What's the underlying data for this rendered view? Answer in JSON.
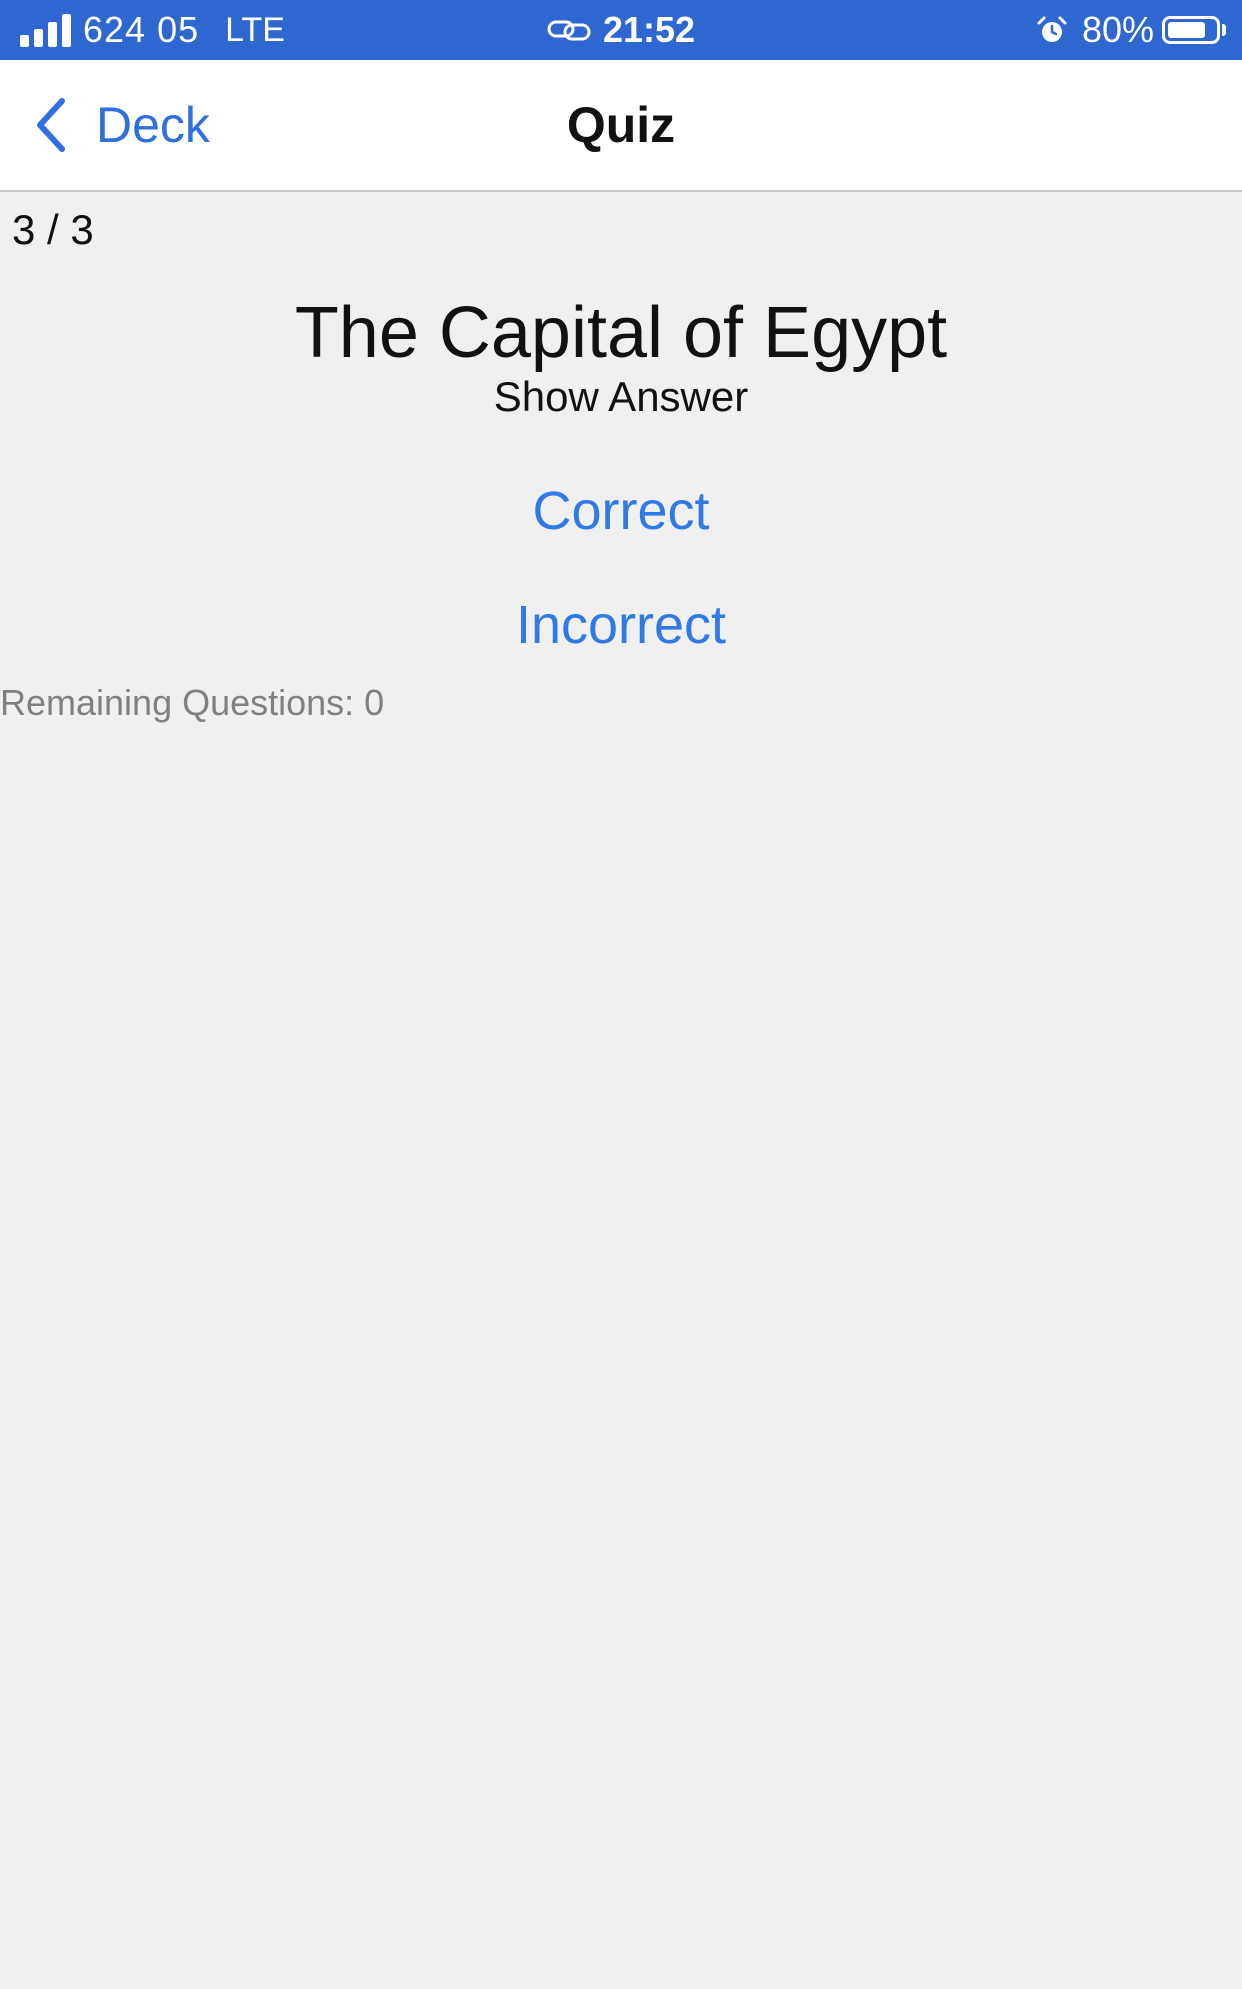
{
  "status_bar": {
    "carrier": "624 05",
    "network": "LTE",
    "time": "21:52",
    "battery_percent": "80%",
    "battery_level": 0.8,
    "icons": [
      "signal-icon",
      "link-icon",
      "alarm-icon",
      "battery-icon"
    ],
    "background_color": "#2f67d1"
  },
  "nav": {
    "back_label": "Deck",
    "title": "Quiz",
    "accent_color": "#2f6fe0"
  },
  "quiz": {
    "progress": "3 / 3",
    "question": "The Capital of Egypt",
    "show_answer_label": "Show Answer",
    "correct_label": "Correct",
    "incorrect_label": "Incorrect",
    "remaining_label": "Remaining Questions: 0"
  }
}
